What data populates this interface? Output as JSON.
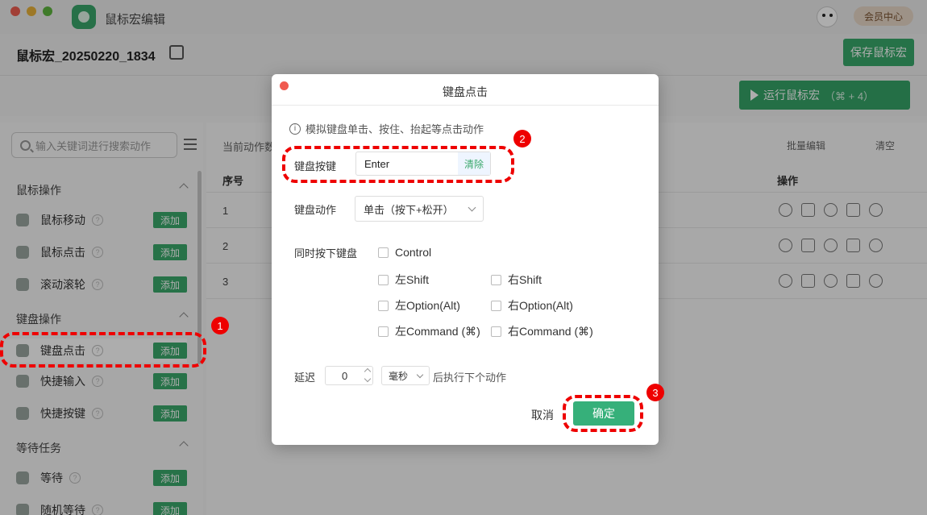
{
  "titlebar": {
    "app_title": "鼠标宏编辑",
    "member_label": "会员中心"
  },
  "header": {
    "macro_name": "鼠标宏_20250220_1834",
    "save_label": "保存鼠标宏"
  },
  "run": {
    "label": "运行鼠标宏",
    "shortcut": "（⌘ + 4）"
  },
  "sidebar": {
    "search_placeholder": "输入关键词进行搜索动作",
    "add_label": "添加",
    "sections": [
      {
        "title": "鼠标操作",
        "items": [
          "鼠标移动",
          "鼠标点击",
          "滚动滚轮"
        ]
      },
      {
        "title": "键盘操作",
        "items": [
          "键盘点击",
          "快捷输入",
          "快捷按键"
        ]
      },
      {
        "title": "等待任务",
        "items": [
          "等待",
          "随机等待"
        ]
      }
    ]
  },
  "main": {
    "toolbar_label": "当前动作数",
    "batch_label": "批量编辑",
    "clear_label": "清空",
    "col_index": "序号",
    "col_ops": "操作",
    "rows": [
      "1",
      "2",
      "3"
    ]
  },
  "dialog": {
    "title": "键盘点击",
    "hint": "模拟键盘单击、按住、抬起等点击动作",
    "key_label": "键盘按键",
    "key_value": "Enter",
    "clear_label": "清除",
    "action_label": "键盘动作",
    "action_value": "单击（按下+松开）",
    "modifiers_label": "同时按下键盘",
    "modifiers": {
      "control": "Control",
      "left_shift": "左Shift",
      "right_shift": "右Shift",
      "left_option": "左Option(Alt)",
      "right_option": "右Option(Alt)",
      "left_command": "左Command (⌘)",
      "right_command": "右Command (⌘)"
    },
    "delay_label": "延迟",
    "delay_value": "0",
    "delay_unit": "毫秒",
    "delay_suffix": "后执行下个动作",
    "cancel_label": "取消",
    "ok_label": "确定"
  },
  "annotations": {
    "badge1": "1",
    "badge2": "2",
    "badge3": "3"
  }
}
